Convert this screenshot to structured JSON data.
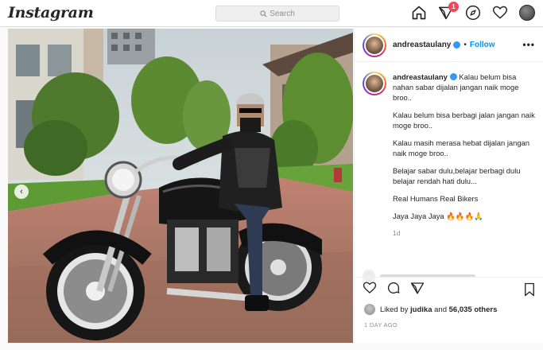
{
  "header": {
    "logo": "Instagram",
    "search_placeholder": "Search",
    "notification_count": "1",
    "icons": [
      "home-icon",
      "direct-icon",
      "explore-icon",
      "heart-icon",
      "profile-avatar"
    ]
  },
  "post": {
    "username": "andreastaulany",
    "verified": true,
    "separator": "•",
    "follow_label": "Follow",
    "more_label": "•••",
    "caption_username": "andreastaulany",
    "caption_paragraphs": [
      "Kalau belum bisa nahan sabar dijalan jangan naik moge broo..",
      "Kalau belum bisa berbagi jalan jangan naik moge broo..",
      "Kalau masih merasa hebat dijalan jangan naik moge broo..",
      "Belajar sabar dulu,belajar berbagi dulu belajar rendah hati dulu...",
      "Real Humans Real Bikers",
      "Jaya Jaya Jaya 🔥🔥🔥🙏"
    ],
    "caption_time": "1d",
    "likes_prefix": "Liked by ",
    "likes_user": "judika",
    "likes_middle": " and ",
    "likes_count": "56,035 others",
    "time_ago": "1 DAY AGO"
  },
  "colors": {
    "accent": "#0095f6",
    "badge": "#ed4956",
    "border": "#dbdbdb"
  }
}
